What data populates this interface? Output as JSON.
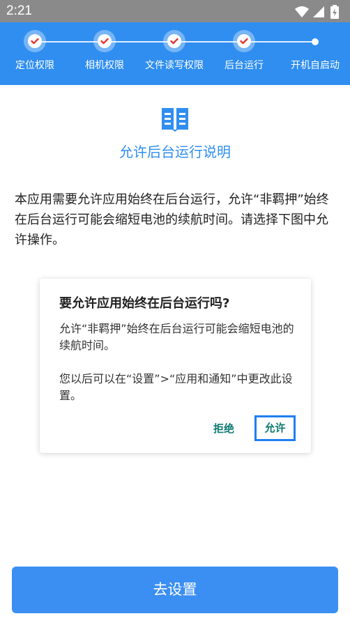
{
  "status_bar": {
    "time": "2:21",
    "icons": [
      "wifi-icon",
      "signal-icon",
      "battery-charging-icon"
    ]
  },
  "steps": [
    {
      "label": "定位权限",
      "state": "done"
    },
    {
      "label": "相机权限",
      "state": "done"
    },
    {
      "label": "文件读写权限",
      "state": "done"
    },
    {
      "label": "后台运行",
      "state": "done"
    },
    {
      "label": "开机自启动",
      "state": "pending"
    }
  ],
  "content": {
    "icon": "book-icon",
    "title": "允许后台运行说明",
    "description": "本应用需要允许应用始终在后台运行，允许“非羁押”始终在后台运行可能会缩短电池的续航时间。请选择下图中允许操作。"
  },
  "dialog_illustration": {
    "title": "要允许应用始终在后台运行吗?",
    "body1": "允许“非羁押”始终在后台运行可能会缩短电池的续航时间。",
    "body2": "您以后可以在“设置”>“应用和通知”中更改此设置。",
    "deny_label": "拒绝",
    "allow_label": "允许"
  },
  "primary_button": {
    "label": "去设置"
  },
  "colors": {
    "accent": "#2f8ef0",
    "button": "#3b8ff3",
    "check": "#e53935",
    "status_bar": "#8a8a8a",
    "dialog_action": "#0f7a72"
  }
}
